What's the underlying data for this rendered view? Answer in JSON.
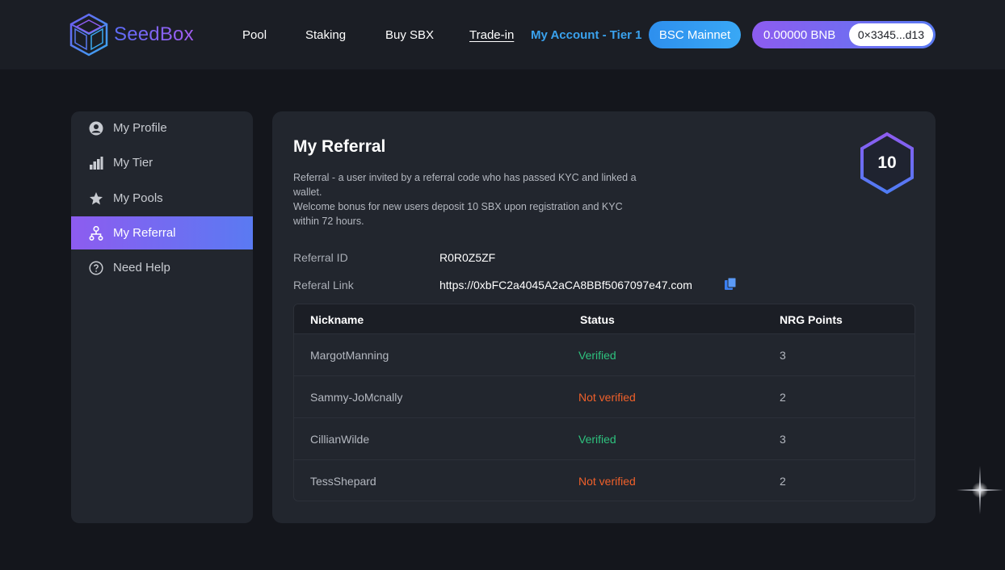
{
  "header": {
    "logo_text": "SeedBox",
    "nav": {
      "pool": "Pool",
      "staking": "Staking",
      "buy_sbx": "Buy SBX",
      "trade_in": "Trade-in",
      "account": "My Account - Tier 1"
    },
    "network_button": "BSC Mainnet",
    "wallet": {
      "balance": "0.00000 BNB",
      "address": "0×3345...d13"
    }
  },
  "sidebar": {
    "items": [
      {
        "label": "My Profile",
        "icon": "user-circle-icon"
      },
      {
        "label": "My Tier",
        "icon": "bar-chart-icon"
      },
      {
        "label": "My Pools",
        "icon": "star-icon"
      },
      {
        "label": "My Referral",
        "icon": "referral-tree-icon",
        "active": true
      },
      {
        "label": "Need Help",
        "icon": "question-circle-icon"
      }
    ]
  },
  "referral": {
    "title": "My Referral",
    "description_1": "Referral - a user invited by a referral code who has passed KYC and linked a wallet.",
    "description_2": "Welcome bonus for new users deposit 10 SBX upon registration and KYC within 72 hours.",
    "badge_value": "10",
    "id_label": "Referral ID",
    "id_value": "R0R0Z5ZF",
    "link_label": "Referal Link",
    "link_value": "https://0xbFC2a4045A2aCA8BBf5067097e47.com"
  },
  "table": {
    "headers": [
      "Nickname",
      "Status",
      "NRG Points"
    ],
    "rows": [
      {
        "nickname": "MargotManning",
        "status": "Verified",
        "points": "3"
      },
      {
        "nickname": "Sammy-JoMcnally",
        "status": "Not verified",
        "points": "2"
      },
      {
        "nickname": "CillianWilde",
        "status": "Verified",
        "points": "3"
      },
      {
        "nickname": "TessShepard",
        "status": "Not verified",
        "points": "2"
      }
    ]
  },
  "colors": {
    "background": "#14161c",
    "card": "#22262e",
    "accent_gradient_start": "#8d5cf0",
    "accent_gradient_end": "#5a7af2",
    "link_blue": "#3aa2ee",
    "verified": "#2ec27e",
    "not_verified": "#f0602a"
  }
}
